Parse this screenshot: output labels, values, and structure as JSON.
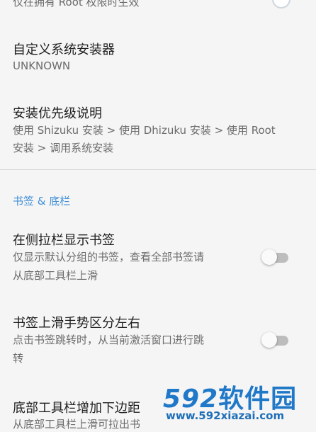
{
  "top_partial": {
    "text": "仅在拥有 Root 权限时生效"
  },
  "installer": {
    "title": "自定义系统安装器",
    "value": "UNKNOWN"
  },
  "priority": {
    "title": "安装优先级说明",
    "line1": "使用 Shizuku 安装 > 使用 Dhizuku 安装 > 使用 Root",
    "line2": "安装 > 调用系统安装"
  },
  "section": {
    "header": "书签 & 底栏"
  },
  "sidebar_bookmarks": {
    "title": "在侧拉栏显示书签",
    "line1": "仅显示默认分组的书签，查看全部书签请",
    "line2": "从底部工具栏上滑",
    "enabled": false
  },
  "swipe_split": {
    "title": "书签上滑手势区分左右",
    "line1": "点击书签跳转时，从当前激活窗口进行跳",
    "line2": "转",
    "enabled": false
  },
  "bottom_margin": {
    "title": "底部工具栏增加下边距",
    "line1": "从底部工具栏上滑可拉出书"
  },
  "watermark": {
    "logo_num": "592",
    "logo_text": "软件园",
    "url": "www.592xiazai.com"
  },
  "colors": {
    "accent": "#3f8fd6",
    "switch_off_track": "#bdbdbd",
    "background": "#f5f5f5"
  }
}
